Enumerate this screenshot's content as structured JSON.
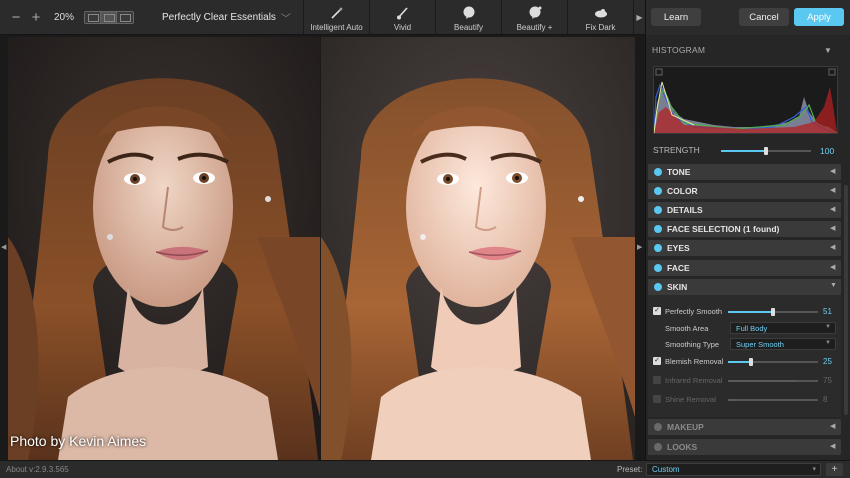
{
  "toolbar": {
    "zoom_out": "−",
    "zoom_in": "+",
    "zoom_level": "20%",
    "preset_name": "Perfectly Clear Essentials",
    "presets": [
      {
        "label": "Intelligent Auto",
        "icon": "wand-icon"
      },
      {
        "label": "Vivid",
        "icon": "brush-icon"
      },
      {
        "label": "Beautify",
        "icon": "beautify-icon"
      },
      {
        "label": "Beautify +",
        "icon": "beautify-plus-icon"
      },
      {
        "label": "Fix Dark",
        "icon": "fix-dark-icon"
      }
    ]
  },
  "actions": {
    "learn": "Learn",
    "cancel": "Cancel",
    "apply": "Apply"
  },
  "viewer": {
    "credit": "Photo by Kevin Aimes"
  },
  "panel": {
    "histogram_title": "HISTOGRAM",
    "strength_label": "STRENGTH",
    "strength_value": "100",
    "strength_level": 1.0,
    "sections": [
      {
        "title": "TONE",
        "expanded": false,
        "enabled": true
      },
      {
        "title": "COLOR",
        "expanded": false,
        "enabled": true
      },
      {
        "title": "DETAILS",
        "expanded": false,
        "enabled": true
      },
      {
        "title": "FACE SELECTION (1 found)",
        "expanded": false,
        "enabled": true
      },
      {
        "title": "EYES",
        "expanded": false,
        "enabled": true
      },
      {
        "title": "FACE",
        "expanded": false,
        "enabled": true
      },
      {
        "title": "SKIN",
        "expanded": true,
        "enabled": true
      },
      {
        "title": "MAKEUP",
        "expanded": false,
        "enabled": false
      },
      {
        "title": "LOOKS",
        "expanded": false,
        "enabled": false
      }
    ],
    "skin": {
      "perfectly_smooth": {
        "label": "Perfectly Smooth",
        "value": "51",
        "checked": true
      },
      "smooth_area": {
        "label": "Smooth Area",
        "value": "Full Body"
      },
      "smoothing_type": {
        "label": "Smoothing Type",
        "value": "Super Smooth"
      },
      "blemish_removal": {
        "label": "Blemish Removal",
        "value": "25",
        "checked": true
      },
      "infrared_removal": {
        "label": "Infrared Removal",
        "value": "75",
        "checked": false
      },
      "shine_removal": {
        "label": "Shine Removal",
        "value": "8",
        "checked": false
      }
    }
  },
  "status": {
    "about": "About v:2.9.3.565",
    "preset_label": "Preset:",
    "preset_value": "Custom",
    "add": "+"
  },
  "colors": {
    "accent": "#5ac8f0",
    "panel_bg": "#262626",
    "section_bg": "#3a3a3a"
  }
}
